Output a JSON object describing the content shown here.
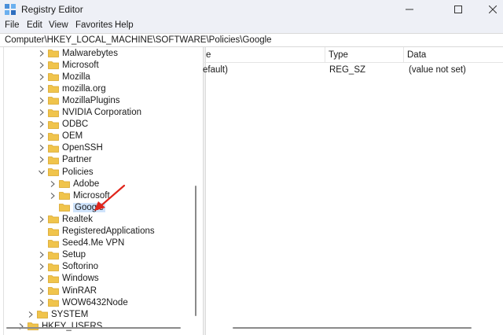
{
  "window": {
    "title": "Registry Editor"
  },
  "menu": [
    "File",
    "Edit",
    "View",
    "Favorites",
    "Help"
  ],
  "address": "Computer\\HKEY_LOCAL_MACHINE\\SOFTWARE\\Policies\\Google",
  "tree": [
    {
      "label": "Malwarebytes",
      "expander": "collapsed"
    },
    {
      "label": "Microsoft",
      "expander": "collapsed"
    },
    {
      "label": "Mozilla",
      "expander": "collapsed"
    },
    {
      "label": "mozilla.org",
      "expander": "collapsed"
    },
    {
      "label": "MozillaPlugins",
      "expander": "collapsed"
    },
    {
      "label": "NVIDIA Corporation",
      "expander": "collapsed"
    },
    {
      "label": "ODBC",
      "expander": "collapsed"
    },
    {
      "label": "OEM",
      "expander": "collapsed"
    },
    {
      "label": "OpenSSH",
      "expander": "collapsed"
    },
    {
      "label": "Partner",
      "expander": "collapsed"
    },
    {
      "label": "Policies",
      "expander": "expanded"
    },
    {
      "label": "Adobe",
      "expander": "collapsed"
    },
    {
      "label": "Microsoft",
      "expander": "collapsed"
    },
    {
      "label": "Google",
      "expander": "none",
      "selected": true
    },
    {
      "label": "Realtek",
      "expander": "collapsed"
    },
    {
      "label": "RegisteredApplications",
      "expander": "none"
    },
    {
      "label": "Seed4.Me VPN",
      "expander": "none"
    },
    {
      "label": "Setup",
      "expander": "collapsed"
    },
    {
      "label": "Softorino",
      "expander": "collapsed"
    },
    {
      "label": "Windows",
      "expander": "collapsed"
    },
    {
      "label": "WinRAR",
      "expander": "collapsed"
    },
    {
      "label": "WOW6432Node",
      "expander": "collapsed"
    },
    {
      "label": "SYSTEM",
      "expander": "collapsed"
    },
    {
      "label": "HKEY_USERS",
      "expander": "collapsed"
    }
  ],
  "list": {
    "columns": [
      "e",
      "Type",
      "Data"
    ],
    "rows": [
      {
        "name": "efault)",
        "type": "REG_SZ",
        "data": "(value not set)"
      }
    ]
  },
  "colors": {
    "folder": "#f0c44c",
    "folder_edge": "#d9a52a",
    "selection": "#cfe3fb",
    "arrow": "#e0251b",
    "chrome": "#eef0f6"
  }
}
